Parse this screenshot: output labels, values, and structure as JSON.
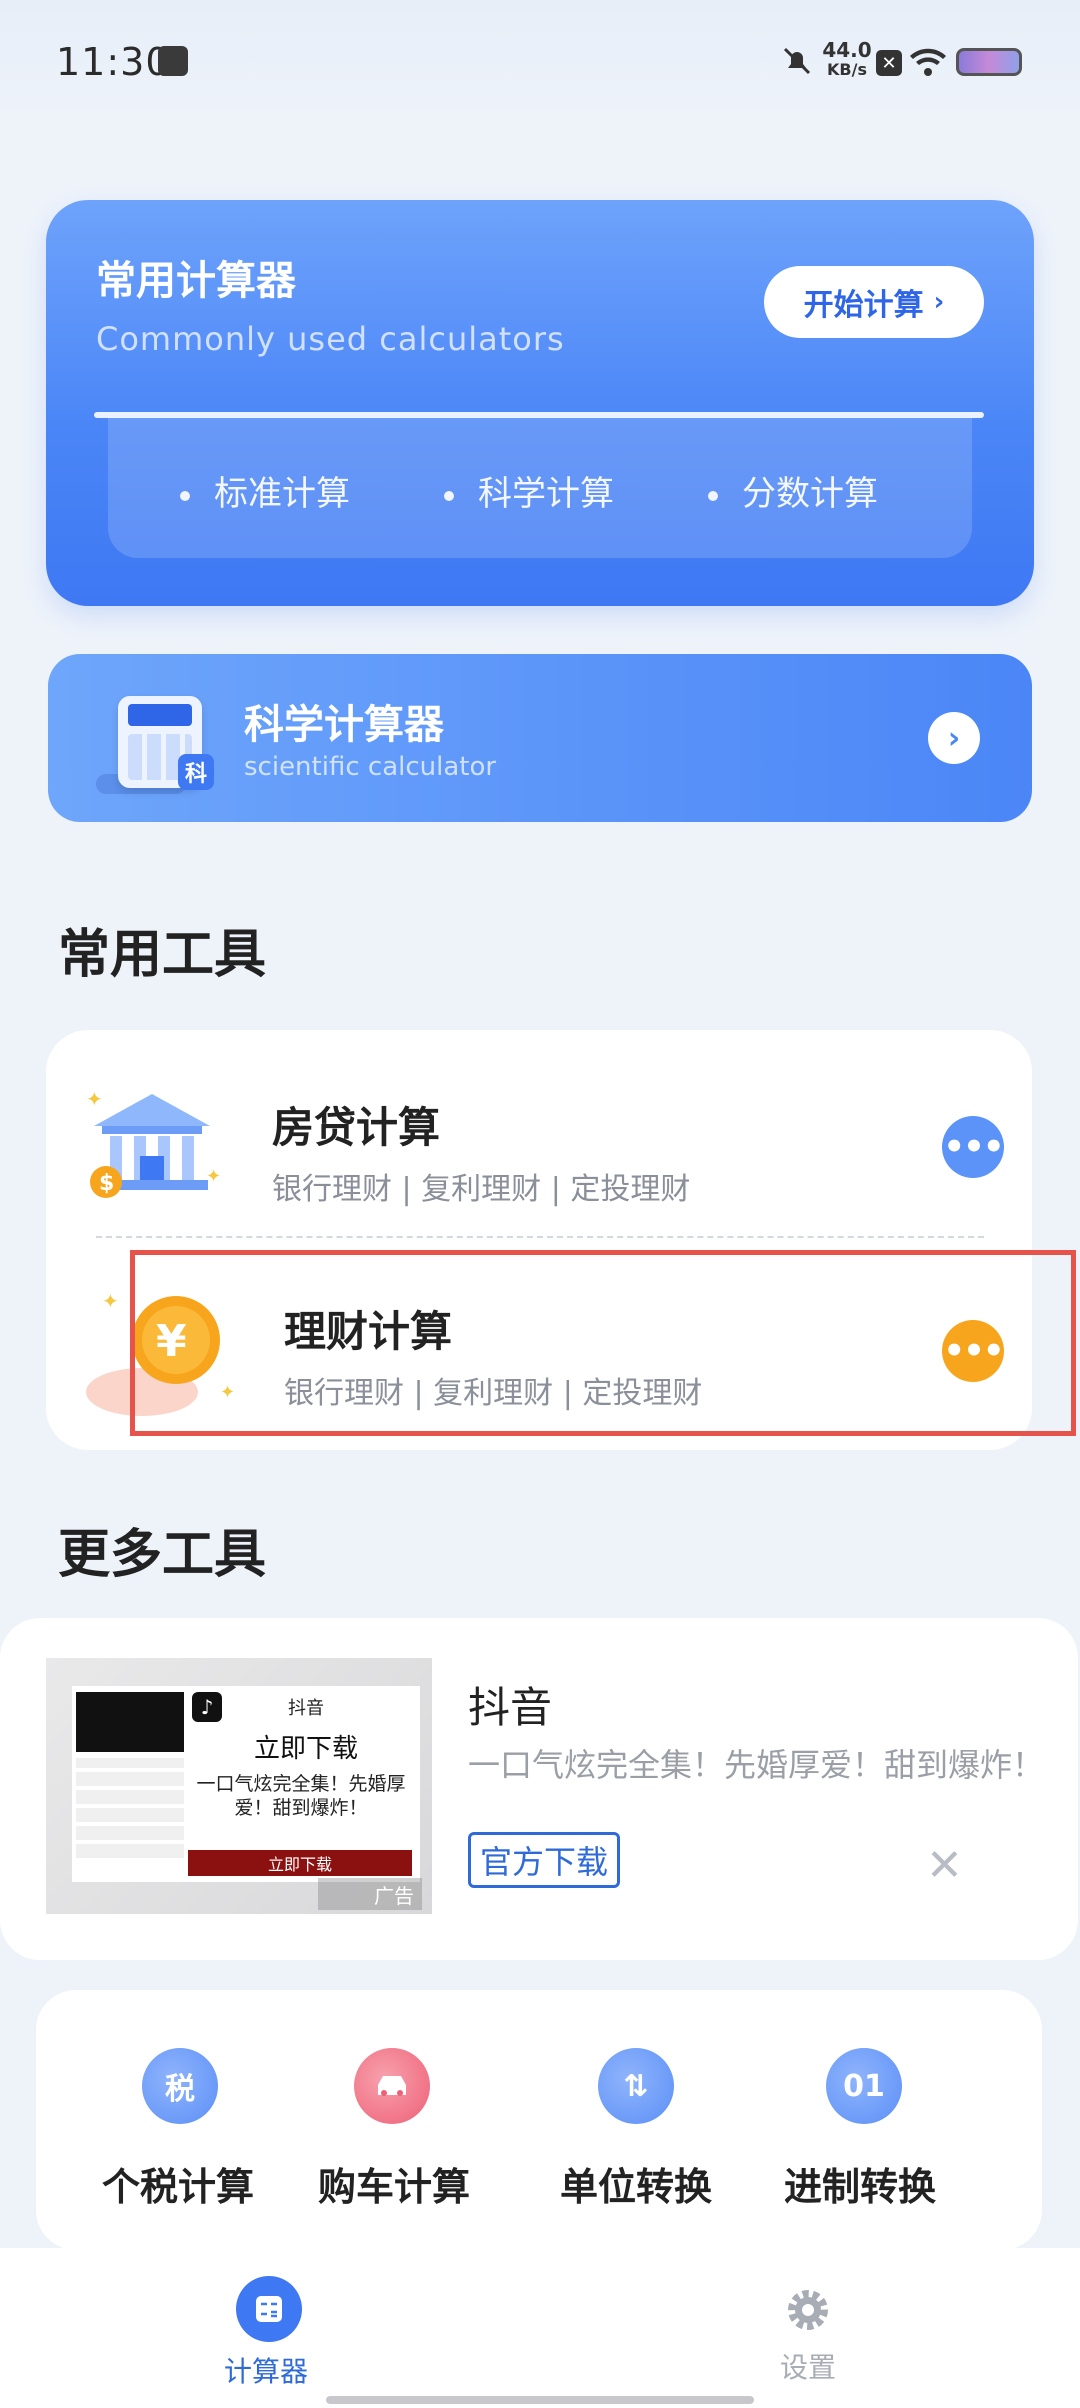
{
  "status_bar": {
    "time": "11:30",
    "net_speed_value": "44.0",
    "net_speed_unit": "KB/s"
  },
  "common_calculator": {
    "title": "常用计算器",
    "subtitle": "Commonly used calculators",
    "start_button": "开始计算",
    "items": [
      "标准计算",
      "科学计算",
      "分数计算"
    ]
  },
  "scientific_calculator": {
    "title": "科学计算器",
    "subtitle": "scientific calculator",
    "badge": "科"
  },
  "common_tools": {
    "section_title": "常用工具",
    "items": [
      {
        "title": "房贷计算",
        "subtitle": "银行理财 | 复利理财 | 定投理财"
      },
      {
        "title": "理财计算",
        "subtitle": "银行理财 | 复利理财 | 定投理财"
      }
    ]
  },
  "more_tools": {
    "section_title": "更多工具",
    "ad": {
      "image_app_name": "抖音",
      "image_headline": "立即下载",
      "image_text": "一口气炫完全集！先婚厚爱！甜到爆炸！",
      "image_button": "立即下载",
      "ad_tag": "广告",
      "app_title": "抖音",
      "description": "一口气炫完全集！先婚厚爱！甜到爆炸！",
      "download_button": "官方下载"
    },
    "tools": [
      {
        "label": "个税计算",
        "icon_text": "税"
      },
      {
        "label": "购车计算",
        "icon_text": ""
      },
      {
        "label": "单位转换",
        "icon_text": ""
      },
      {
        "label": "进制转换",
        "icon_text": "01"
      }
    ]
  },
  "bottom_nav": {
    "items": [
      {
        "label": "计算器"
      },
      {
        "label": "设置"
      }
    ]
  },
  "colors": {
    "primary": "#3e78f3",
    "orange": "#f7a51c",
    "highlight": "#e5534b"
  }
}
